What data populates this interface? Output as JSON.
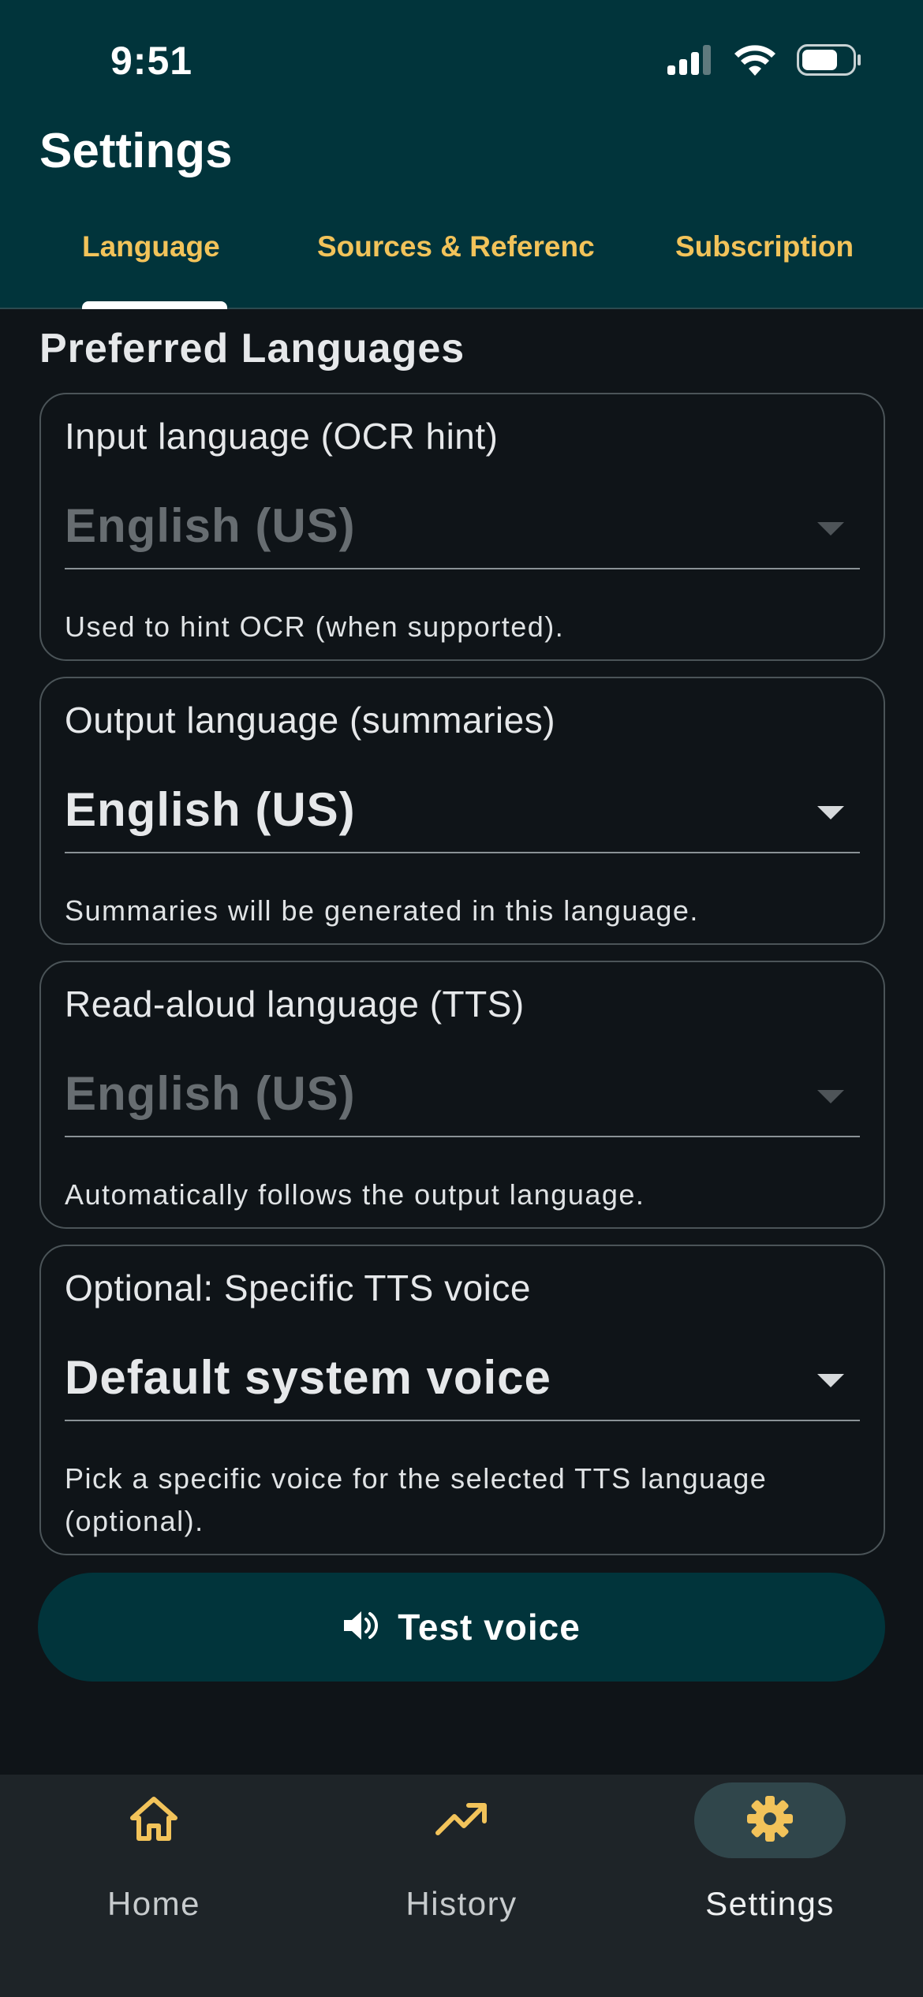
{
  "status_bar": {
    "time": "9:51",
    "icons": [
      "signal-icon",
      "wifi-icon",
      "battery-icon"
    ]
  },
  "header": {
    "title": "Settings",
    "tabs": [
      {
        "label": "Language",
        "active": true
      },
      {
        "label": "Sources & Referenc",
        "active": false
      },
      {
        "label": "Subscription",
        "active": false
      }
    ]
  },
  "main": {
    "section_title": "Preferred Languages",
    "cards": [
      {
        "label": "Input language (OCR hint)",
        "value": "English (US)",
        "disabled": true,
        "helper": "Used to hint OCR (when supported)."
      },
      {
        "label": "Output language (summaries)",
        "value": "English (US)",
        "disabled": false,
        "helper": "Summaries will be generated in this language."
      },
      {
        "label": "Read-aloud language (TTS)",
        "value": "English (US)",
        "disabled": true,
        "helper": "Automatically follows the output language."
      },
      {
        "label": "Optional: Specific TTS voice",
        "value": "Default system voice",
        "disabled": false,
        "helper": "Pick a specific voice for the selected TTS language (optional)."
      }
    ],
    "test_button": {
      "label": "Test voice",
      "icon": "speaker-icon"
    }
  },
  "bottom_nav": {
    "items": [
      {
        "label": "Home",
        "icon": "home-icon",
        "active": false
      },
      {
        "label": "History",
        "icon": "trending-up-icon",
        "active": false
      },
      {
        "label": "Settings",
        "icon": "gear-icon",
        "active": true
      }
    ]
  },
  "colors": {
    "header_bg": "#01343b",
    "accent": "#f2c35a",
    "background": "#0f1418",
    "nav_bg": "#1e2428"
  }
}
